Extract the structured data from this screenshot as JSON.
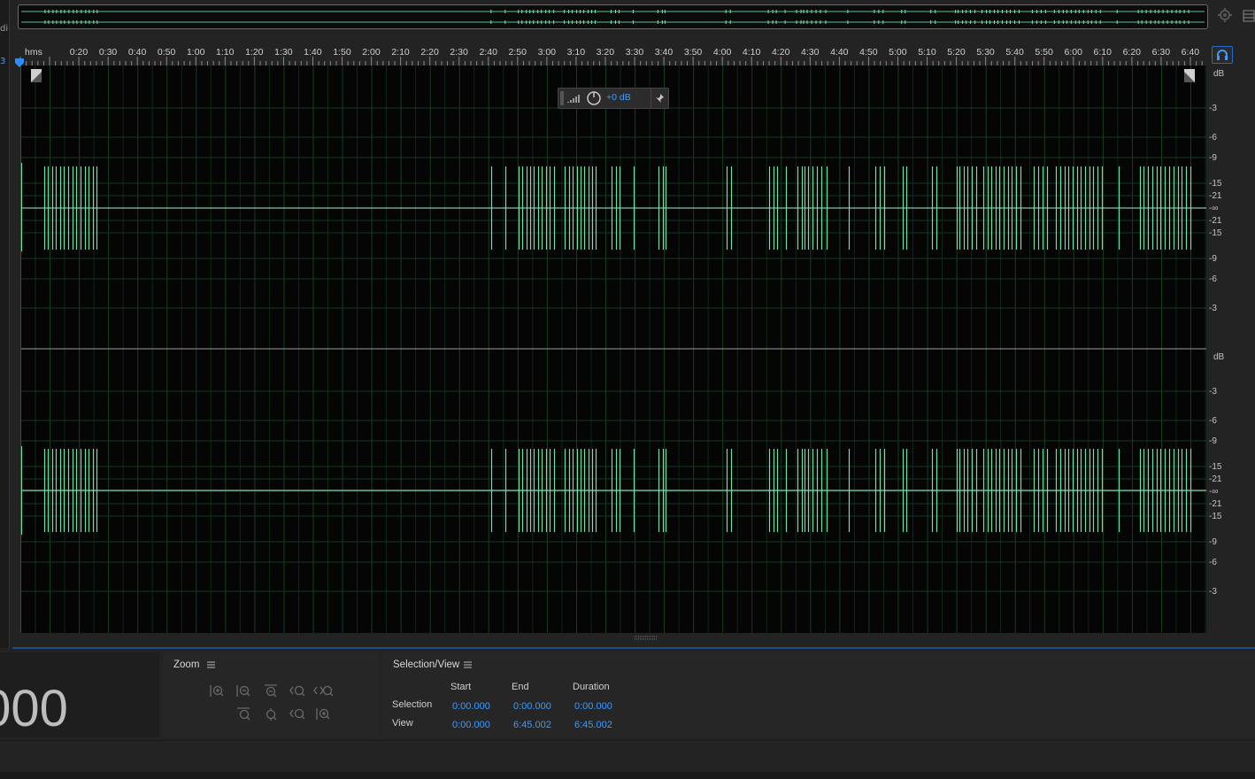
{
  "left_edge": {
    "top_char": "di",
    "side_char": "3"
  },
  "ruler": {
    "unit": "hms",
    "ticks": [
      "0:20",
      "0:30",
      "0:40",
      "0:50",
      "1:00",
      "1:10",
      "1:20",
      "1:30",
      "1:40",
      "1:50",
      "2:00",
      "2:10",
      "2:20",
      "2:30",
      "2:40",
      "2:50",
      "3:00",
      "3:10",
      "3:20",
      "3:30",
      "3:40",
      "3:50",
      "4:00",
      "4:10",
      "4:20",
      "4:30",
      "4:40",
      "4:50",
      "5:00",
      "5:10",
      "5:20",
      "5:30",
      "5:40",
      "5:50",
      "6:00",
      "6:10",
      "6:20",
      "6:30",
      "6:40"
    ]
  },
  "db_scale": {
    "channel_1": [
      "dB",
      "-3",
      "-6",
      "-9",
      "-15",
      "-21",
      "-∞",
      "-21",
      "-15",
      "-9",
      "-6",
      "-3"
    ],
    "channel_2": [
      "dB",
      "-3",
      "-6",
      "-9",
      "-15",
      "-21",
      "-∞",
      "-21",
      "-15",
      "-9",
      "-6",
      "-3"
    ]
  },
  "hud": {
    "gain_value": "+0 dB"
  },
  "time_display": {
    "value": ".000"
  },
  "zoom_panel": {
    "title": "Zoom"
  },
  "selection_view": {
    "title": "Selection/View",
    "headers": {
      "start": "Start",
      "end": "End",
      "duration": "Duration"
    },
    "rows": [
      {
        "label": "Selection",
        "start": "0:00.000",
        "end": "0:00.000",
        "duration": "0:00.000"
      },
      {
        "label": "View",
        "start": "0:00.000",
        "end": "6:45.002",
        "duration": "6:45.002"
      }
    ]
  },
  "colors": {
    "waveform": "#6fe0a8",
    "grid": "#1b4a26",
    "accent": "#3d9bff"
  }
}
